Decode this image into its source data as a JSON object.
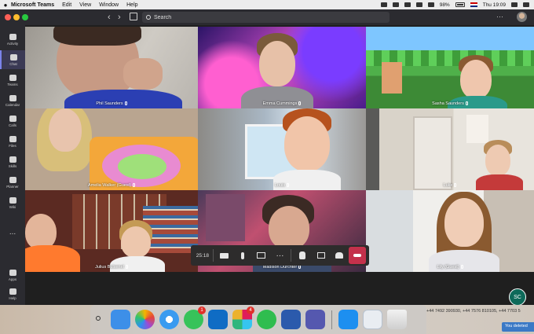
{
  "menubar": {
    "app_name": "Microsoft Teams",
    "menus": [
      "Edit",
      "View",
      "Window",
      "Help"
    ],
    "battery": "98%",
    "clock": "Thu 19:09"
  },
  "titlebar": {
    "search_placeholder": "Search"
  },
  "rail": {
    "items": [
      {
        "label": "Activity",
        "icon": "bell-icon"
      },
      {
        "label": "Chat",
        "icon": "chat-icon"
      },
      {
        "label": "Teams",
        "icon": "teams-icon"
      },
      {
        "label": "Calendar",
        "icon": "calendar-icon"
      },
      {
        "label": "Calls",
        "icon": "phone-icon"
      },
      {
        "label": "Files",
        "icon": "file-icon"
      },
      {
        "label": "Skills",
        "icon": "skills-icon"
      },
      {
        "label": "Planner",
        "icon": "planner-icon"
      },
      {
        "label": "Wiki",
        "icon": "wiki-icon"
      }
    ],
    "bottom": [
      {
        "label": "Apps",
        "icon": "apps-icon"
      },
      {
        "label": "Help",
        "icon": "help-icon"
      }
    ],
    "more": "..."
  },
  "participants": [
    {
      "name": "Phil Saunders"
    },
    {
      "name": "Emma Cummings"
    },
    {
      "name": "Sasha Saunders"
    },
    {
      "name": "Amelia Walker (Guest)"
    },
    {
      "name": "Louis"
    },
    {
      "name": "Luke"
    },
    {
      "name": "Julius Bulsenel"
    },
    {
      "name": "Madison Durchter"
    },
    {
      "name": "Lily (Guest)"
    }
  ],
  "call_toolbar": {
    "timer": "25:18"
  },
  "me": {
    "initials": "SC"
  },
  "dock": {
    "apps": [
      {
        "name": "finder",
        "color": "#3d8fe8"
      },
      {
        "name": "photos",
        "color": "#f2f2f2"
      },
      {
        "name": "safari",
        "color": "#3a9bf0"
      },
      {
        "name": "messages",
        "color": "#37c35a",
        "badge": "1"
      },
      {
        "name": "outlook",
        "color": "#0f6cc4"
      },
      {
        "name": "slack",
        "color": "#ffffff",
        "badge": "4"
      },
      {
        "name": "whatsapp",
        "color": "#2fbd4f"
      },
      {
        "name": "word",
        "color": "#2b5aac"
      },
      {
        "name": "teams",
        "color": "#5558af"
      },
      {
        "name": "app-store",
        "color": "#1d8ff0"
      },
      {
        "name": "preview",
        "color": "#e9edf2"
      },
      {
        "name": "trash",
        "color": "#d9d9d9"
      }
    ]
  },
  "notification": {
    "phones": "+44 7492 390930, +44 7576 810105, +44 7703 5",
    "deleted": "You deleted"
  }
}
